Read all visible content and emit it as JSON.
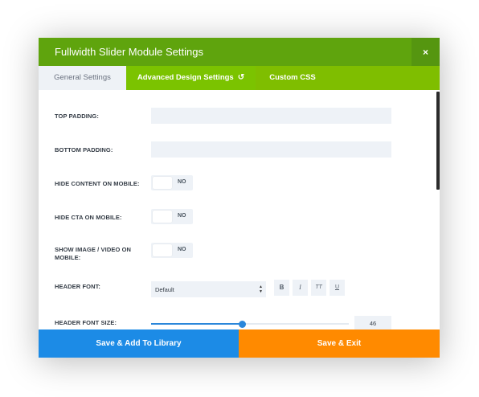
{
  "modal": {
    "title": "Fullwidth Slider Module Settings",
    "close_label": "×"
  },
  "tabs": [
    {
      "label": "General Settings",
      "active": false
    },
    {
      "label": "Advanced Design Settings",
      "active": true,
      "icon": "reset-icon"
    },
    {
      "label": "Custom CSS",
      "active": false
    }
  ],
  "settings": {
    "top_padding": {
      "label": "Top Padding:",
      "value": ""
    },
    "bottom_padding": {
      "label": "Bottom Padding:",
      "value": ""
    },
    "hide_content_mobile": {
      "label": "Hide Content On Mobile:",
      "state": "NO"
    },
    "hide_cta_mobile": {
      "label": "Hide CTA On Mobile:",
      "state": "NO"
    },
    "show_image_mobile": {
      "label_line1": "Show Image / Video On",
      "label_line2": "Mobile:",
      "state": "NO"
    },
    "header_font": {
      "label": "Header Font:",
      "selected": "Default",
      "style_buttons": [
        "B",
        "I",
        "TT",
        "U"
      ]
    },
    "header_font_size": {
      "label": "Header Font Size:",
      "value": "46",
      "slider_fraction": 0.46
    }
  },
  "footer": {
    "library_label": "Save & Add To Library",
    "exit_label": "Save & Exit"
  },
  "colors": {
    "header_bg": "#5fa40d",
    "tab_bar_bg": "#7fbe00",
    "library_button": "#1c8be6",
    "exit_button": "#ff8a00",
    "slider_accent": "#2b87da"
  }
}
